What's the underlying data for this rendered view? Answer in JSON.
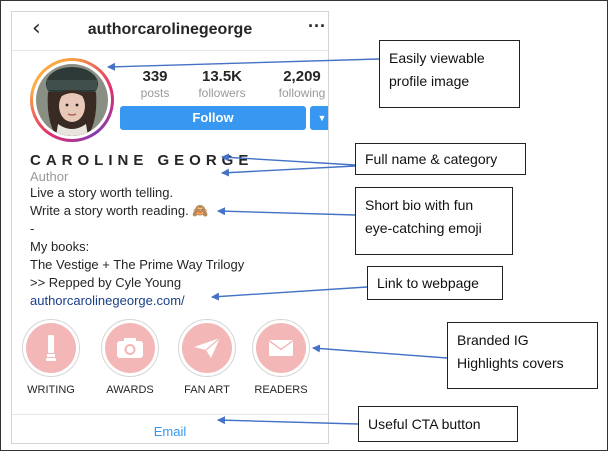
{
  "profile": {
    "username": "authorcarolinegeorge",
    "back_icon": "‹",
    "more_icon": "···",
    "stats": [
      {
        "value": "339",
        "label": "posts"
      },
      {
        "value": "13.5K",
        "label": "followers"
      },
      {
        "value": "2,209",
        "label": "following"
      }
    ],
    "follow_label": "Follow",
    "dropdown_icon": "▼",
    "full_name": "CAROLINE GEORGE",
    "category": "Author",
    "bio": [
      "Live a story worth telling.",
      "Write a story worth reading. 🙈",
      "-",
      "My books:",
      "The Vestige + The Prime Way Trilogy",
      ">> Repped by Cyle Young"
    ],
    "website": "authorcarolinegeorge.com/",
    "highlights": [
      {
        "label": "WRITING",
        "icon": "pencil-icon"
      },
      {
        "label": "AWARDS",
        "icon": "camera-icon"
      },
      {
        "label": "FAN ART",
        "icon": "paper-plane-icon"
      },
      {
        "label": "READERS",
        "icon": "envelope-icon"
      }
    ],
    "email_label": "Email"
  },
  "callouts": {
    "profile_image": "Easily viewable profile image",
    "name_category": "Full name & category",
    "bio": "Short bio with fun eye-catching emoji",
    "link": "Link to webpage",
    "highlights": "Branded IG Highlights covers",
    "cta": "Useful CTA button"
  },
  "colors": {
    "instagram_blue": "#3897f0",
    "highlight_pink": "#f3b7b7",
    "link_navy": "#1a3f8a",
    "arrow_blue": "#4472c4"
  }
}
